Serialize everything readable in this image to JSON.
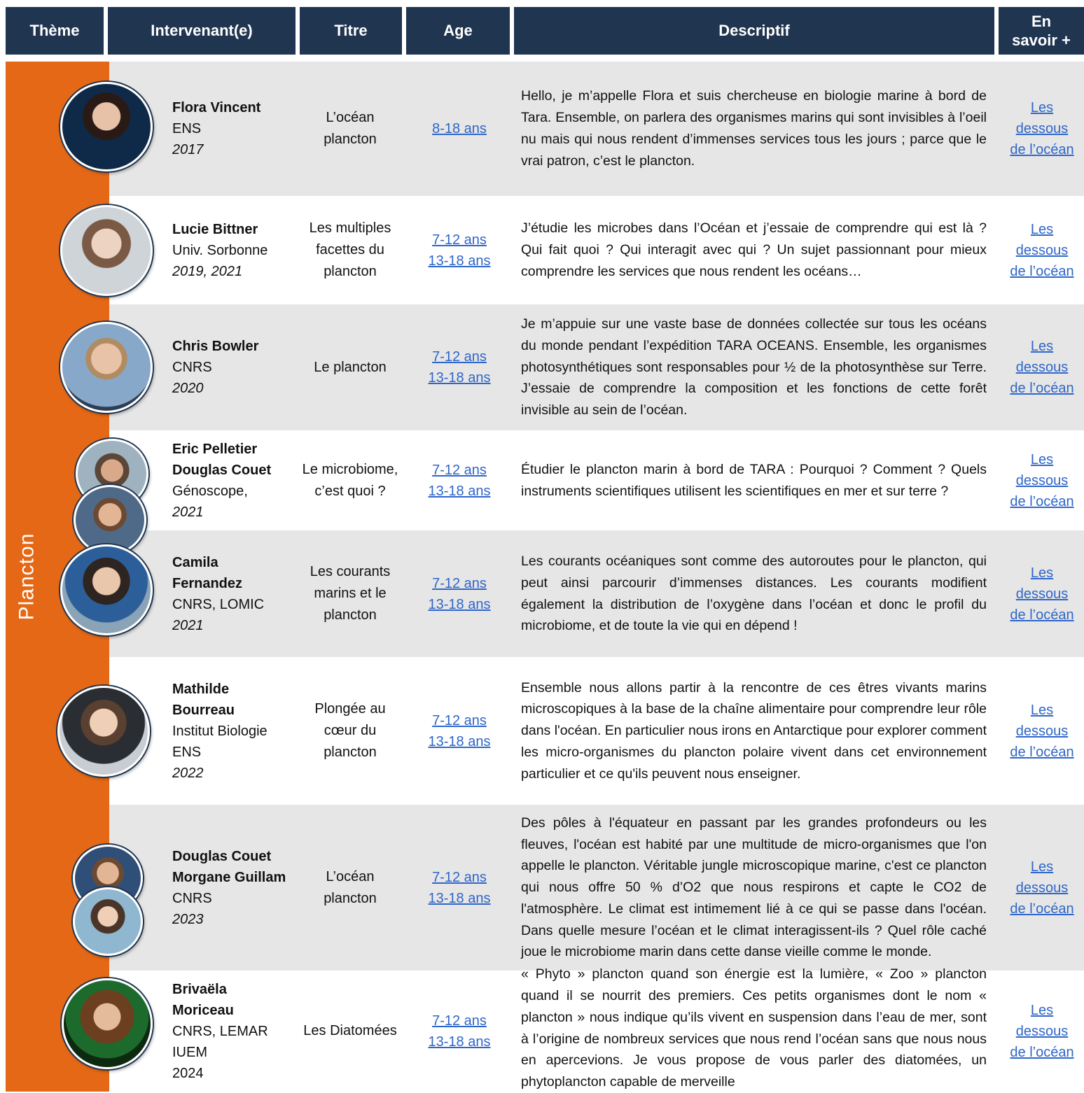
{
  "header": {
    "theme": "Thème",
    "speaker": "Intervenant(e)",
    "title": "Titre",
    "age": "Age",
    "description": "Descriptif",
    "more_line1": "En",
    "more_line2": "savoir +"
  },
  "theme": "Plancton",
  "more_link": {
    "line1": "Les",
    "line2": "dessous",
    "line3": "de l’océan"
  },
  "rows": [
    {
      "names": [
        "Flora Vincent"
      ],
      "affiliation": [
        "ENS"
      ],
      "year": "2017",
      "title": "L’océan plancton",
      "ages": [
        "8-18 ans"
      ],
      "description": "Hello, je m’appelle Flora et suis chercheuse en biologie marine à bord de Tara. Ensemble, on parlera des organismes marins qui sont invisibles à l’oeil nu mais qui nous rendent d’immenses services tous les jours ; parce que le vrai patron, c’est le plancton."
    },
    {
      "names": [
        "Lucie Bittner"
      ],
      "affiliation": [
        "Univ. Sorbonne"
      ],
      "year": "2019, 2021",
      "title": "Les multiples facettes du plancton",
      "ages": [
        "7-12 ans",
        "13-18 ans"
      ],
      "description": "J’étudie les microbes dans l’Océan et j’essaie de comprendre qui est là ? Qui fait quoi ? Qui interagit avec qui ? Un sujet passionnant pour mieux comprendre les services que nous rendent les océans…"
    },
    {
      "names": [
        "Chris Bowler"
      ],
      "affiliation": [
        "CNRS"
      ],
      "year": "2020",
      "title": "Le plancton",
      "ages": [
        "7-12 ans",
        "13-18 ans"
      ],
      "description": "Je m’appuie sur une vaste base de données collectée sur tous les océans du monde pendant l’expédition TARA OCEANS. Ensemble, les organismes photosynthétiques sont responsables pour ½ de la photosynthèse sur Terre. J’essaie de comprendre la composition et les fonctions de cette forêt invisible au sein de l’océan."
    },
    {
      "names": [
        "Eric Pelletier",
        "Douglas Couet"
      ],
      "affiliation": [
        "Génoscope,"
      ],
      "year": "2021",
      "title": "Le microbiome, c’est quoi ?",
      "ages": [
        "7-12 ans",
        "13-18 ans"
      ],
      "description": "Étudier le plancton marin à bord de TARA : Pourquoi ? Comment ? Quels instruments scientifiques utilisent les scientifiques en mer et sur terre ?"
    },
    {
      "names": [
        "Camila Fernandez"
      ],
      "affiliation": [
        "CNRS, LOMIC"
      ],
      "year": "2021",
      "title": "Les courants marins et le plancton",
      "ages": [
        "7-12 ans",
        "13-18 ans"
      ],
      "description": "Les courants océaniques sont comme des autoroutes pour le plancton, qui peut ainsi parcourir d’immenses distances. Les courants modifient également la distribution de l’oxygène dans l’océan et donc le profil du microbiome, et de toute la vie qui en dépend !"
    },
    {
      "names": [
        "Mathilde Bourreau"
      ],
      "affiliation": [
        "Institut Biologie",
        "ENS"
      ],
      "year": "2022",
      "title": "Plongée au cœur du plancton",
      "ages": [
        "7-12 ans",
        "13-18 ans"
      ],
      "description": "Ensemble nous allons partir à la rencontre de ces êtres vivants marins microscopiques à la base de la chaîne alimentaire pour comprendre leur rôle dans l'océan. En particulier nous irons en Antarctique pour explorer comment les micro-organismes du plancton polaire vivent dans cet environnement particulier et ce qu'ils peuvent nous enseigner."
    },
    {
      "names": [
        "Douglas Couet",
        "Morgane Guillam"
      ],
      "affiliation": [
        "CNRS"
      ],
      "year": "2023",
      "title": "L’océan plancton",
      "ages": [
        "7-12 ans",
        "13-18 ans"
      ],
      "description": "Des pôles à l'équateur en passant par les grandes profondeurs ou les fleuves, l'océan est habité par une multitude de micro-organismes que l'on appelle le plancton. Véritable jungle microscopique marine, c'est ce plancton qui nous offre 50 % d’O2 que nous respirons et capte le CO2 de l'atmosphère. Le climat est intimement lié à ce qui se passe dans l'océan. Dans quelle mesure l’océan et le climat interagissent-ils ? Quel rôle caché joue le microbiome marin dans cette danse vieille comme le monde."
    },
    {
      "names": [
        "Brivaëla Moriceau"
      ],
      "affiliation": [
        "CNRS, LEMAR",
        "IUEM"
      ],
      "year": "2024",
      "title": "Les Diatomées",
      "ages": [
        "7-12 ans",
        "13-18 ans"
      ],
      "description": "« Phyto » plancton quand son énergie est la lumière, « Zoo » plancton quand il se nourrit des premiers. Ces petits organismes dont le nom « plancton » nous indique qu’ils vivent en suspension dans l’eau de mer, sont à l’origine de nombreux services que nous rend l’océan sans que nous nous en apercevions. Je vous propose de vous parler des diatomées, un phytoplancton capable de merveille"
    }
  ]
}
